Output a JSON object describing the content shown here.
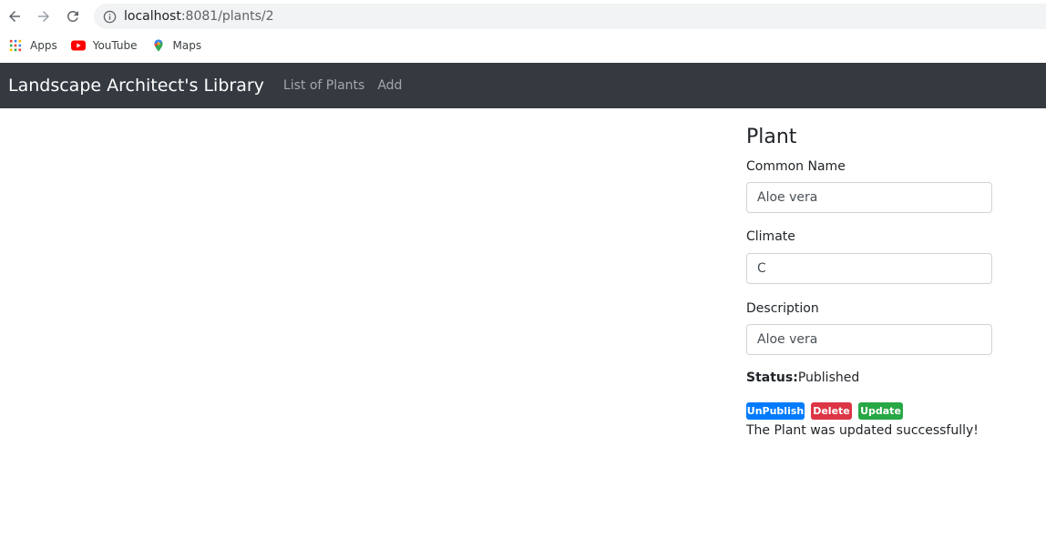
{
  "browser": {
    "url_host": "localhost",
    "url_rest": ":8081/plants/2",
    "bookmarks": [
      {
        "label": "Apps",
        "icon": "apps-grid-icon"
      },
      {
        "label": "YouTube",
        "icon": "youtube-icon"
      },
      {
        "label": "Maps",
        "icon": "maps-pin-icon"
      }
    ]
  },
  "navbar": {
    "brand": "Landscape Architect's Library",
    "links": [
      "List of Plants",
      "Add"
    ]
  },
  "form": {
    "title": "Plant",
    "fields": [
      {
        "label": "Common Name",
        "value": "Aloe vera"
      },
      {
        "label": "Climate",
        "value": "C"
      },
      {
        "label": "Description",
        "value": "Aloe vera"
      }
    ],
    "status_label": "Status:",
    "status_value": "Published",
    "buttons": {
      "unpublish": "UnPublish",
      "delete": "Delete",
      "update": "Update"
    },
    "message": "The Plant was updated successfully!"
  },
  "colors": {
    "navbar_bg": "#343a40",
    "primary": "#007bff",
    "danger": "#dc3545",
    "success": "#28a745"
  }
}
